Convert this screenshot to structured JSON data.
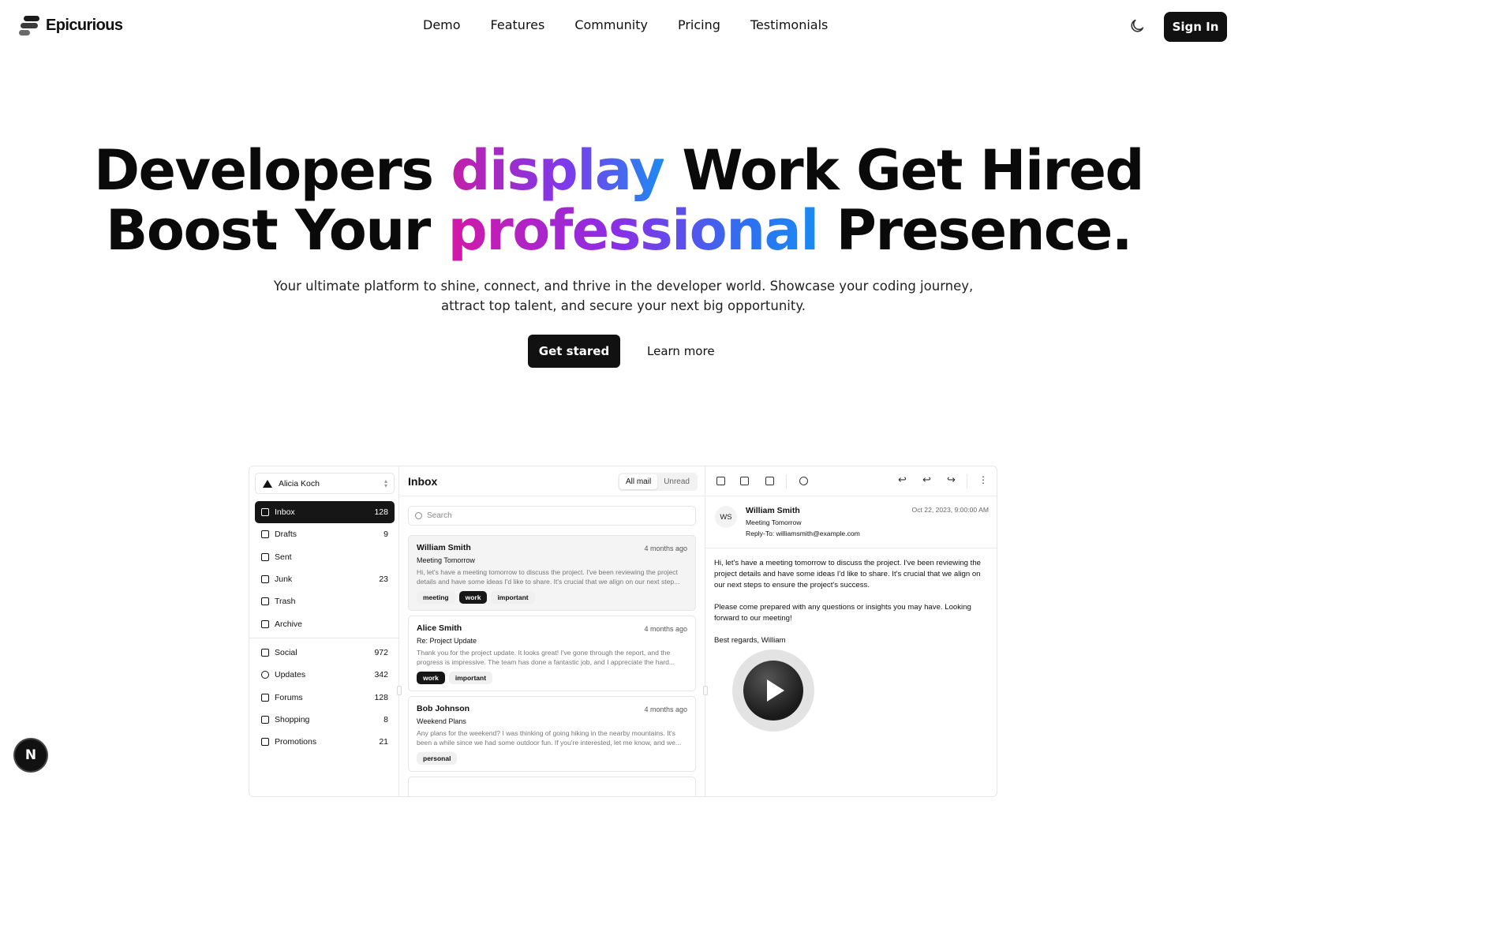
{
  "nav": {
    "brand": "Epicurious",
    "links": [
      "Demo",
      "Features",
      "Community",
      "Pricing",
      "Testimonials"
    ],
    "signin_label": "Sign In",
    "theme_icon": "moon-icon"
  },
  "hero": {
    "line1_a": "Developers ",
    "line1_grad": "display",
    "line1_b": " Work Get Hired",
    "line2_a": "Boost Your ",
    "line2_grad": "professional",
    "line2_b": " Presence.",
    "subtitle": "Your ultimate platform to shine, connect, and thrive in the developer world. Showcase your coding journey, attract top talent, and secure your next big opportunity.",
    "primary_cta": "Get stared",
    "secondary_cta": "Learn more"
  },
  "demo": {
    "account": "Alicia Koch",
    "folders": [
      {
        "label": "Inbox",
        "count": "128",
        "icon": "inbox-icon"
      },
      {
        "label": "Drafts",
        "count": "9",
        "icon": "file-icon"
      },
      {
        "label": "Sent",
        "count": "",
        "icon": "send-icon"
      },
      {
        "label": "Junk",
        "count": "23",
        "icon": "archive-x-icon"
      },
      {
        "label": "Trash",
        "count": "",
        "icon": "trash-icon"
      },
      {
        "label": "Archive",
        "count": "",
        "icon": "archive-icon"
      }
    ],
    "categories": [
      {
        "label": "Social",
        "count": "972",
        "icon": "users-icon"
      },
      {
        "label": "Updates",
        "count": "342",
        "icon": "alert-circle-icon"
      },
      {
        "label": "Forums",
        "count": "128",
        "icon": "messages-icon"
      },
      {
        "label": "Shopping",
        "count": "8",
        "icon": "cart-icon"
      },
      {
        "label": "Promotions",
        "count": "21",
        "icon": "archive-icon"
      }
    ],
    "inbox_title": "Inbox",
    "filters": [
      "All mail",
      "Unread"
    ],
    "search_placeholder": "Search",
    "mails": [
      {
        "from": "William Smith",
        "date": "4 months ago",
        "subject": "Meeting Tomorrow",
        "body": "Hi, let's have a meeting tomorrow to discuss the project. I've been reviewing the project details and have some ideas I'd like to share. It's crucial that we align on our next step...",
        "tags": [
          "meeting",
          "work",
          "important"
        ]
      },
      {
        "from": "Alice Smith",
        "date": "4 months ago",
        "subject": "Re: Project Update",
        "body": "Thank you for the project update. It looks great! I've gone through the report, and the progress is impressive. The team has done a fantastic job, and I appreciate the hard...",
        "tags": [
          "work",
          "important"
        ]
      },
      {
        "from": "Bob Johnson",
        "date": "4 months ago",
        "subject": "Weekend Plans",
        "body": "Any plans for the weekend? I was thinking of going hiking in the nearby mountains. It's been a while since we had some outdoor fun. If you're interested, let me know, and we...",
        "tags": [
          "personal"
        ]
      }
    ],
    "reader": {
      "avatar": "WS",
      "from": "William Smith",
      "subject": "Meeting Tomorrow",
      "reply_to": "Reply-To: williamsmith@example.com",
      "date": "Oct 22, 2023, 9:00:00 AM",
      "paragraphs": [
        "Hi, let's have a meeting tomorrow to discuss the project. I've been reviewing the project details and have some ideas I'd like to share. It's crucial that we align on our next steps to ensure the project's success.",
        "Please come prepared with any questions or insights you may have. Looking forward to our meeting!",
        "Best regards, William"
      ]
    }
  },
  "badge": "N"
}
